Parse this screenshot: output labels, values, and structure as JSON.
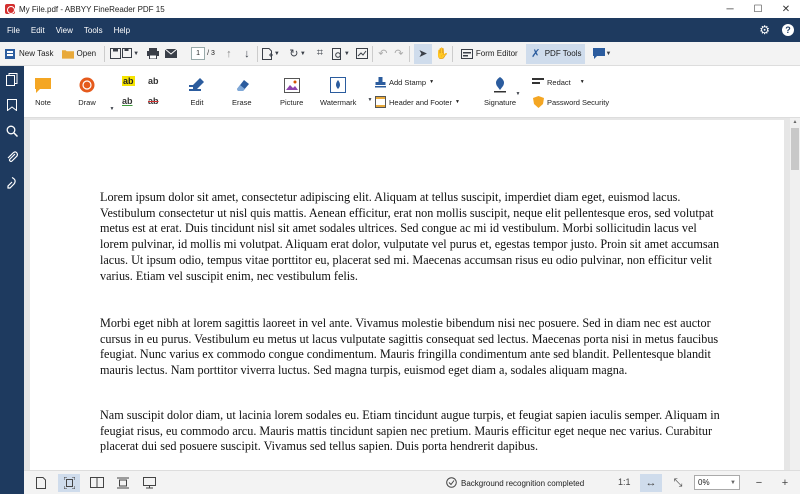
{
  "window": {
    "title": "My File.pdf - ABBYY FineReader PDF 15",
    "minimize_glyph": "─",
    "maximize_glyph": "☐",
    "close_glyph": "✕"
  },
  "menu": {
    "items": [
      "File",
      "Edit",
      "View",
      "Tools",
      "Help"
    ]
  },
  "toolbar": {
    "new_task": "New Task",
    "open": "Open",
    "page_current": "1",
    "page_total": "/ 3",
    "form_editor": "Form Editor",
    "pdf_tools": "PDF Tools"
  },
  "ribbon": {
    "note": "Note",
    "draw": "Draw",
    "edit": "Edit",
    "erase": "Erase",
    "picture": "Picture",
    "watermark": "Watermark",
    "add_stamp": "Add Stamp",
    "header_footer": "Header and Footer",
    "signature": "Signature",
    "redact": "Redact",
    "password_security": "Password Security",
    "ab_glyph": "ab"
  },
  "document": {
    "paragraphs": [
      "Lorem ipsum dolor sit amet, consectetur adipiscing elit. Aliquam at tellus suscipit, imperdiet diam eget, euismod lacus. Vestibulum consectetur ut nisl quis mattis. Aenean efficitur, erat non mollis suscipit, neque elit pellentesque eros, sed volutpat metus est at erat. Duis tincidunt nisl sit amet sodales ultrices. Sed congue ac mi id vestibulum. Morbi sollicitudin lacus vel lorem pulvinar, id mollis mi volutpat. Aliquam erat dolor, vulputate vel purus et, egestas tempor justo. Proin sit amet accumsan lacus. Ut ipsum odio, tempus vitae porttitor eu, placerat sed mi. Maecenas accumsan risus eu odio pulvinar, non efficitur velit varius. Etiam vel suscipit enim, nec vestibulum felis.",
      "Morbi eget nibh at lorem sagittis laoreet in vel ante. Vivamus molestie bibendum nisi nec posuere. Sed in diam nec est auctor cursus in eu purus. Vestibulum eu metus ut lacus vulputate sagittis consequat sed lectus. Maecenas porta nisi in metus faucibus feugiat. Nunc varius ex commodo congue condimentum. Mauris fringilla condimentum ante sed blandit. Pellentesque blandit mauris lectus. Nam porttitor viverra luctus. Sed magna turpis, euismod eget diam a, sodales aliquam magna.",
      "Nam suscipit dolor diam, ut lacinia lorem sodales eu. Etiam tincidunt augue turpis, et feugiat sapien iaculis semper. Aliquam in feugiat risus, eu commodo arcu. Mauris mattis tincidunt sapien nec pretium. Mauris efficitur eget neque nec varius. Curabitur placerat dui sed posuere suscipit. Vivamus sed tellus sapien. Duis porta hendrerit dapibus."
    ]
  },
  "status": {
    "recognition": "Background recognition completed",
    "ratio": "1:1",
    "zoom": "0%"
  },
  "colors": {
    "nav_dark": "#1e3a5f",
    "active_bg": "#cfdcec",
    "logo_red": "#d32f2f"
  }
}
